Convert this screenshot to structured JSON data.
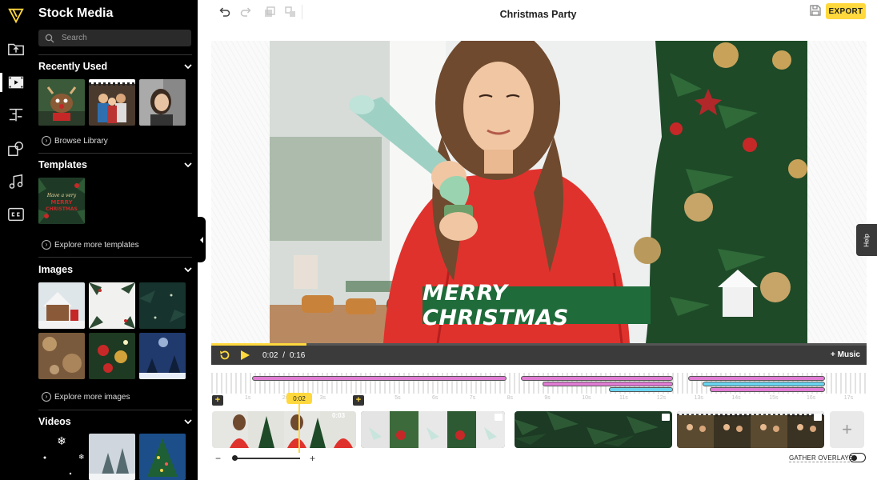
{
  "app": {
    "project_title": "Christmas Party",
    "export_label": "EXPORT",
    "help_label": "Help"
  },
  "rail": {
    "items": [
      "upload-icon",
      "stock-media-icon",
      "text-icon",
      "shapes-icon",
      "music-icon",
      "captions-icon"
    ],
    "active": "stock-media-icon",
    "brand_color": "#ffd83d"
  },
  "sidebar": {
    "title": "Stock Media",
    "search_placeholder": "Search",
    "sections": {
      "recent": {
        "label": "Recently Used",
        "link": "Browse Library"
      },
      "templates": {
        "label": "Templates",
        "link": "Explore more templates",
        "template_text": [
          "Have a very",
          "MERRY",
          "CHRISTMAS"
        ]
      },
      "images": {
        "label": "Images",
        "link": "Explore more images"
      },
      "videos": {
        "label": "Videos"
      }
    }
  },
  "preview": {
    "caption": "MERRY CHRISTMAS",
    "caption_bg": "#1f6b3a"
  },
  "playback": {
    "current_time": "0:02",
    "separator": "/",
    "total_time": "0:16",
    "progress_fraction": 0.145,
    "music_label": "+ Music"
  },
  "timeline": {
    "ticks": [
      "1s",
      "2s",
      "3s",
      "4s",
      "5s",
      "6s",
      "7s",
      "8s",
      "9s",
      "10s",
      "11s",
      "12s",
      "13s",
      "14s",
      "15s",
      "16s",
      "17s"
    ],
    "playhead_label": "0:02",
    "clip_time": "0:03",
    "add_marker_label": "+",
    "add_clip_label": "+",
    "zoom_minus": "−",
    "zoom_plus": "+",
    "gather_overlays_label": "GATHER OVERLAYS",
    "gather_overlays_on": false
  }
}
